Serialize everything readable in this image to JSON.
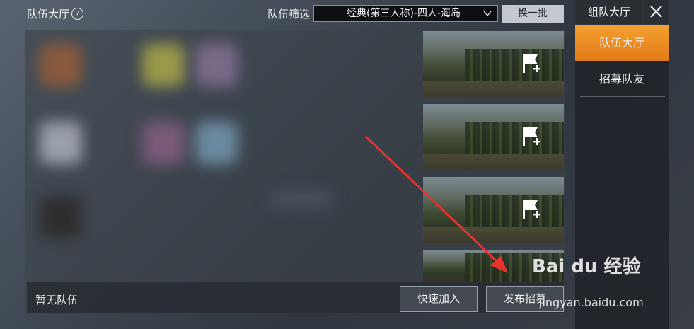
{
  "header": {
    "title": "队伍大厅",
    "help_icon": "question-circle-icon",
    "filter_label": "队伍筛选",
    "filter_value": "经典(第三人称)-四人-海岛",
    "refresh_label": "换一批"
  },
  "team_list": {
    "empty_text": "暂无队伍",
    "quick_join_label": "快速加入",
    "post_recruit_label": "发布招募",
    "map_cards": [
      {
        "icon": "flag-plus-icon"
      },
      {
        "icon": "flag-plus-icon"
      },
      {
        "icon": "flag-plus-icon"
      },
      {
        "icon": "flag-plus-icon"
      }
    ]
  },
  "sidebar": {
    "title": "组队大厅",
    "close_icon": "close-icon",
    "items": [
      {
        "label": "队伍大厅",
        "active": true
      },
      {
        "label": "招募队友",
        "active": false
      }
    ]
  },
  "watermark": {
    "logo": "Bai du 经验",
    "url": "jingyan.baidu.com"
  },
  "colors": {
    "accent": "#f08a24",
    "annotation_arrow": "#e8322e"
  }
}
